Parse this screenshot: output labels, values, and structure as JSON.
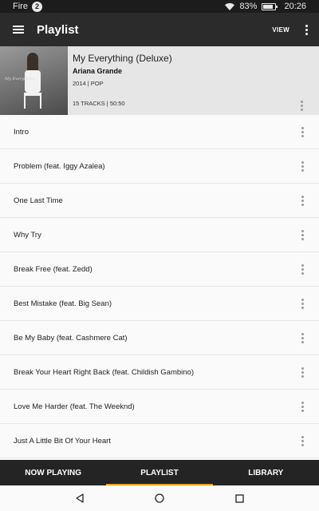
{
  "status_bar": {
    "carrier": "Fire",
    "notification_count": "2",
    "battery_percent": "83%",
    "battery_level": 0.83,
    "time": "20:26",
    "icons": [
      "wifi-icon",
      "battery-icon"
    ]
  },
  "app_bar": {
    "title": "Playlist",
    "view_label": "VIEW",
    "icons": [
      "menu-icon",
      "overflow-menu-icon"
    ]
  },
  "album": {
    "title": "My Everything (Deluxe)",
    "artist": "Ariana Grande",
    "year_genre": "2014 | POP",
    "tracks_duration": "15 TRACKS | 50:50",
    "art_script": "My Everything"
  },
  "tracks": [
    "Intro",
    "Problem (feat. Iggy Azalea)",
    "One Last Time",
    "Why Try",
    "Break Free (feat. Zedd)",
    "Best Mistake (feat. Big Sean)",
    "Be My Baby (feat. Cashmere Cat)",
    "Break Your Heart Right Back (feat. Childish Gambino)",
    "Love Me Harder (feat. The Weeknd)",
    "Just A Little Bit Of Your Heart"
  ],
  "bottom_tabs": {
    "now_playing": "NOW PLAYING",
    "playlist": "PLAYLIST",
    "library": "LIBRARY",
    "active": "playlist"
  },
  "colors": {
    "accent": "#f0a020",
    "app_bar_bg": "#2b2b2b",
    "bottom_bar_bg": "#242424",
    "album_header_bg": "#e6e6e6"
  },
  "nav_bar": {
    "icons": [
      "back-icon",
      "home-icon",
      "recents-icon"
    ]
  }
}
